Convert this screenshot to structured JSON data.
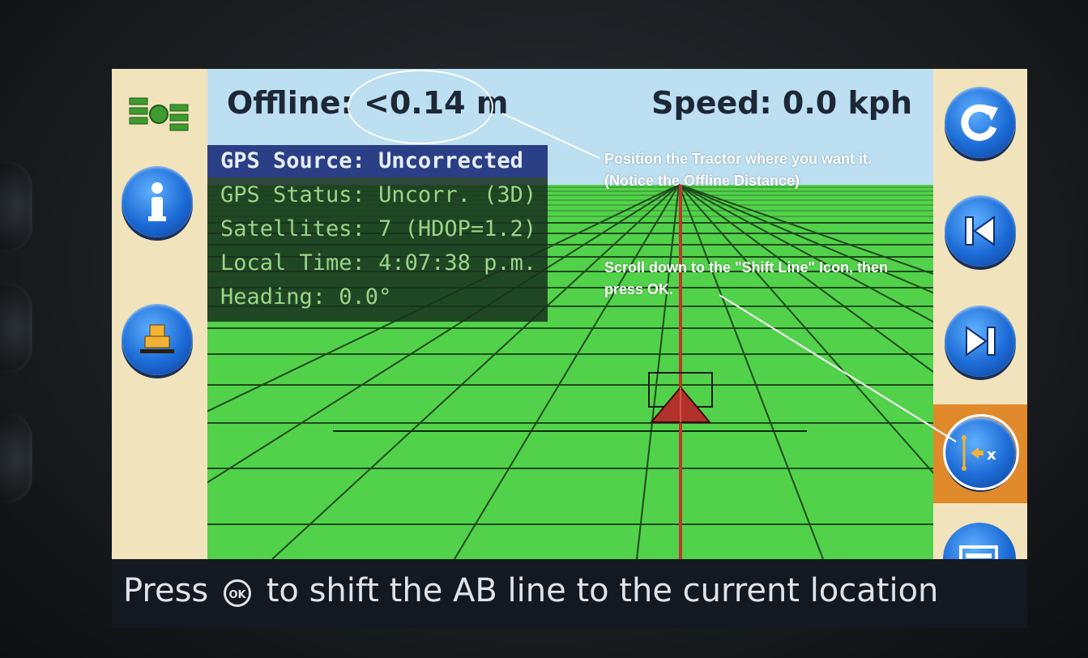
{
  "header": {
    "offline_label": "Offline:",
    "offline_value": "<0.14 m",
    "speed_label": "Speed:",
    "speed_value": "0.0 kph"
  },
  "status": {
    "gps_source": "GPS Source: Uncorrected",
    "gps_status": "GPS Status: Uncorr. (3D)",
    "satellites": "Satellites: 7 (HDOP=1.2)",
    "local_time": "Local Time:  4:07:38 p.m.",
    "heading": "Heading: 0.0°"
  },
  "annotations": {
    "position_note": "Position the Tractor where you want it. (Notice the Offline Distance)",
    "scroll_note": "Scroll down to the \"Shift Line\" Icon, then press OK."
  },
  "bottom_bar": {
    "prefix": "Press",
    "ok_glyph": "OK",
    "suffix": "to shift the AB line to the current location"
  },
  "icons": {
    "left": [
      "satellite-icon",
      "info-icon",
      "implement-icon"
    ],
    "right": [
      "reset-icon",
      "previous-line-icon",
      "next-line-icon",
      "shift-line-icon",
      "menu-icon"
    ]
  },
  "colors": {
    "panel": "#f1e3bc",
    "sky": "#bcdff1",
    "field": "#52d24a",
    "button_blue": "#1c6bd6",
    "selected_orange": "#e08a2c",
    "guidance_line": "#c0392b"
  }
}
